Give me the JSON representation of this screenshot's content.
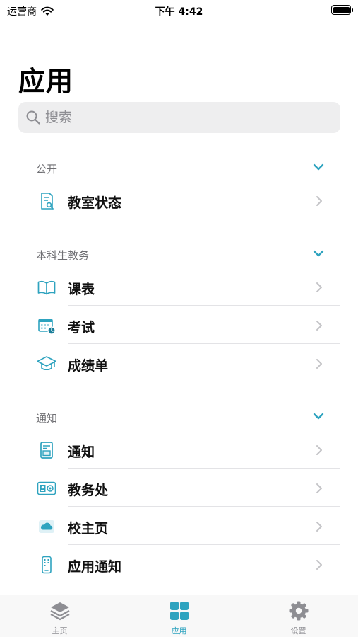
{
  "status_bar": {
    "carrier": "运营商",
    "time": "下午 4:42"
  },
  "page": {
    "title": "应用"
  },
  "search": {
    "placeholder": "搜索"
  },
  "colors": {
    "accent": "#2ea3bf",
    "chevron": "#c4c4c7",
    "inactive": "#8e8e93"
  },
  "sections": {
    "public": {
      "title": "公开",
      "items": [
        {
          "label": "教室状态",
          "icon": "classroom-document-icon"
        }
      ]
    },
    "undergrad": {
      "title": "本科生教务",
      "items": [
        {
          "label": "课表",
          "icon": "book-icon"
        },
        {
          "label": "考试",
          "icon": "calendar-clock-icon"
        },
        {
          "label": "成绩单",
          "icon": "graduation-cap-icon"
        }
      ]
    },
    "notice": {
      "title": "通知",
      "items": [
        {
          "label": "通知",
          "icon": "notice-board-icon"
        },
        {
          "label": "教务处",
          "icon": "contact-card-icon"
        },
        {
          "label": "校主页",
          "icon": "cloud-icon"
        },
        {
          "label": "应用通知",
          "icon": "phone-icon"
        }
      ]
    }
  },
  "tab_bar": {
    "tabs": [
      {
        "label": "主页",
        "icon": "layers-icon",
        "active": false
      },
      {
        "label": "应用",
        "icon": "grid-icon",
        "active": true
      },
      {
        "label": "设置",
        "icon": "gear-icon",
        "active": false
      }
    ]
  }
}
